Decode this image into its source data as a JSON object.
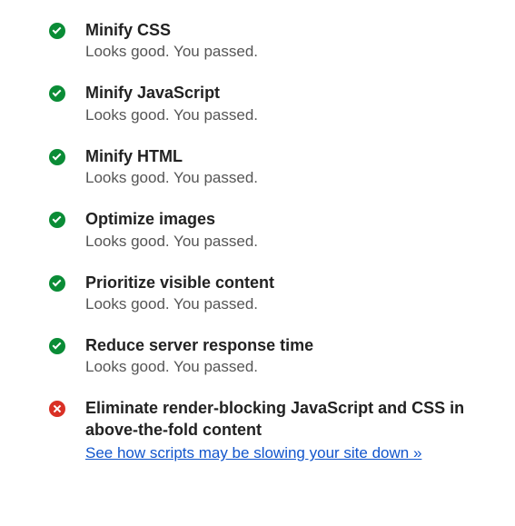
{
  "passed_subtitle": "Looks good. You passed.",
  "items": [
    {
      "status": "pass",
      "title": "Minify CSS",
      "subtitle_key": "passed_subtitle"
    },
    {
      "status": "pass",
      "title": "Minify JavaScript",
      "subtitle_key": "passed_subtitle"
    },
    {
      "status": "pass",
      "title": "Minify HTML",
      "subtitle_key": "passed_subtitle"
    },
    {
      "status": "pass",
      "title": "Optimize images",
      "subtitle_key": "passed_subtitle"
    },
    {
      "status": "pass",
      "title": "Prioritize visible content",
      "subtitle_key": "passed_subtitle"
    },
    {
      "status": "pass",
      "title": "Reduce server response time",
      "subtitle_key": "passed_subtitle"
    },
    {
      "status": "fail",
      "title": "Eliminate render-blocking JavaScript and CSS in above-the-fold content",
      "link_text": "See how scripts may be slowing your site down »"
    }
  ],
  "colors": {
    "pass": "#0a8c36",
    "fail": "#d93025",
    "link": "#1155cc"
  }
}
